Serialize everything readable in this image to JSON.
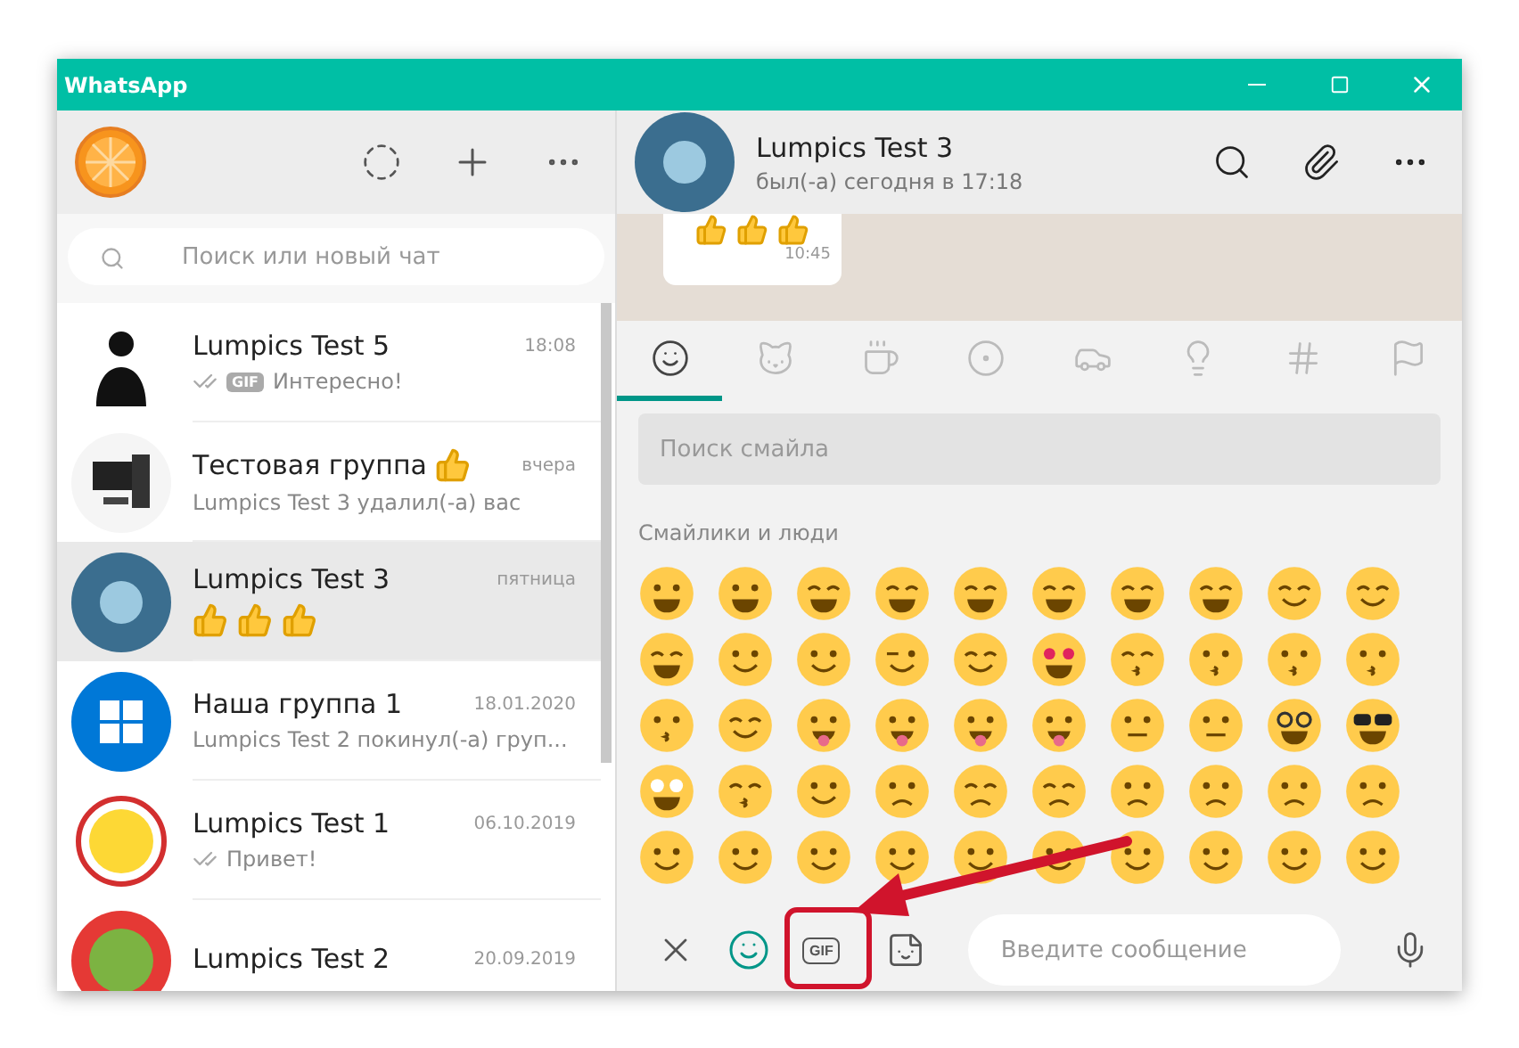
{
  "window": {
    "title": "WhatsApp"
  },
  "sidebar": {
    "search": {
      "placeholder": "Поиск или новый чат"
    },
    "chats": [
      {
        "name": "Lumpics Test 5",
        "time": "18:08",
        "avatar": {
          "kind": "person"
        },
        "ticks": true,
        "badge": "GIF",
        "preview": "Интересно!",
        "selected": false
      },
      {
        "name": "Тестовая группа",
        "name_icon": {
          "kind": "thumbs-up"
        },
        "time": "вчера",
        "avatar": {
          "kind": "computer"
        },
        "ticks": false,
        "preview": "Lumpics Test 3 удалил(-а) вас",
        "selected": false
      },
      {
        "name": "Lumpics Test 3",
        "time": "пятница",
        "avatar": {
          "kind": "photo"
        },
        "ticks": false,
        "preview_icons": [
          {
            "kind": "thumbs-up"
          },
          {
            "kind": "thumbs-up"
          },
          {
            "kind": "thumbs-up"
          }
        ],
        "selected": true
      },
      {
        "name": "Наша группа 1",
        "time": "18.01.2020",
        "avatar": {
          "kind": "windows"
        },
        "ticks": false,
        "preview": "Lumpics Test 2 покинул(-а) груп...",
        "selected": false
      },
      {
        "name": "Lumpics Test 1",
        "time": "06.10.2019",
        "avatar": {
          "kind": "lemon"
        },
        "ticks": true,
        "preview": "Привет!",
        "selected": false
      },
      {
        "name": "Lumpics Test 2",
        "time": "20.09.2019",
        "avatar": {
          "kind": "lime"
        },
        "ticks": false,
        "selected": false
      }
    ]
  },
  "chat": {
    "contact": "Lumpics Test 3",
    "avatar": {
      "kind": "photo"
    },
    "status": "был(-а) сегодня в 17:18",
    "message": {
      "icons": [
        {
          "kind": "thumbs-up"
        },
        {
          "kind": "thumbs-up"
        },
        {
          "kind": "thumbs-up"
        }
      ],
      "time": "10:45"
    }
  },
  "emoji_panel": {
    "tabs": [
      {
        "kind": "smileys",
        "selected": true
      },
      {
        "kind": "animals",
        "selected": false
      },
      {
        "kind": "food",
        "selected": false
      },
      {
        "kind": "sports",
        "selected": false
      },
      {
        "kind": "travel",
        "selected": false
      },
      {
        "kind": "objects",
        "selected": false
      },
      {
        "kind": "symbols",
        "selected": false
      },
      {
        "kind": "flags",
        "selected": false
      }
    ],
    "search": {
      "placeholder": "Поиск смайла"
    },
    "section": "Смайлики и люди",
    "emoji": [
      {
        "kind": "grin"
      },
      {
        "kind": "grin"
      },
      {
        "kind": "laugh"
      },
      {
        "kind": "laugh"
      },
      {
        "kind": "squint"
      },
      {
        "kind": "sweat"
      },
      {
        "kind": "tears"
      },
      {
        "kind": "tears"
      },
      {
        "kind": "blush"
      },
      {
        "kind": "blush"
      },
      {
        "kind": "halo"
      },
      {
        "kind": "smile"
      },
      {
        "kind": "smile"
      },
      {
        "kind": "wink"
      },
      {
        "kind": "relieved"
      },
      {
        "kind": "heart-eyes"
      },
      {
        "kind": "hearts"
      },
      {
        "kind": "kiss"
      },
      {
        "kind": "kiss"
      },
      {
        "kind": "kiss"
      },
      {
        "kind": "kiss"
      },
      {
        "kind": "blush"
      },
      {
        "kind": "tongue"
      },
      {
        "kind": "tongue"
      },
      {
        "kind": "tongue"
      },
      {
        "kind": "zany"
      },
      {
        "kind": "neutral"
      },
      {
        "kind": "monocle"
      },
      {
        "kind": "nerd"
      },
      {
        "kind": "sunglasses"
      },
      {
        "kind": "star"
      },
      {
        "kind": "party"
      },
      {
        "kind": "smirk"
      },
      {
        "kind": "unamused"
      },
      {
        "kind": "pensive"
      },
      {
        "kind": "pensive"
      },
      {
        "kind": "worried"
      },
      {
        "kind": "confused"
      },
      {
        "kind": "frown"
      },
      {
        "kind": "frown"
      },
      {
        "kind": "smile"
      },
      {
        "kind": "smile"
      },
      {
        "kind": "smile"
      },
      {
        "kind": "smile"
      },
      {
        "kind": "smile"
      },
      {
        "kind": "smile"
      },
      {
        "kind": "smile"
      },
      {
        "kind": "smile"
      },
      {
        "kind": "smile"
      },
      {
        "kind": "smile"
      }
    ]
  },
  "composer": {
    "placeholder": "Введите сообщение",
    "gif_label": "GIF",
    "gif_highlighted": true
  }
}
